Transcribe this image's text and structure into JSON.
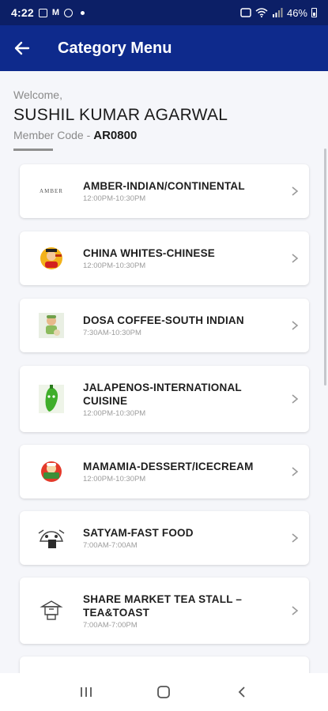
{
  "status_bar": {
    "time": "4:22",
    "battery": "46%"
  },
  "app_bar": {
    "title": "Category Menu"
  },
  "member": {
    "welcome": "Welcome,",
    "name": "SUSHIL KUMAR AGARWAL",
    "code_label": "Member Code -",
    "code": "AR0800"
  },
  "categories": [
    {
      "name": "AMBER-INDIAN/CONTINENTAL",
      "hours": "12:00PM-10:30PM",
      "logo_text": "AMBER"
    },
    {
      "name": "CHINA WHITES-CHINESE",
      "hours": "12:00PM-10:30PM"
    },
    {
      "name": "DOSA COFFEE-SOUTH INDIAN",
      "hours": "7:30AM-10:30PM"
    },
    {
      "name": "JALAPENOS-INTERNATIONAL CUISINE",
      "hours": "12:00PM-10:30PM"
    },
    {
      "name": "MAMAMIA-DESSERT/ICECREAM",
      "hours": "12:00PM-10:30PM"
    },
    {
      "name": "SATYAM-FAST FOOD",
      "hours": "7:00AM-7:00AM"
    },
    {
      "name": "SHARE MARKET TEA STALL – TEA&TOAST",
      "hours": "7:00AM-7:00PM"
    },
    {
      "name": "",
      "hours": ""
    }
  ]
}
